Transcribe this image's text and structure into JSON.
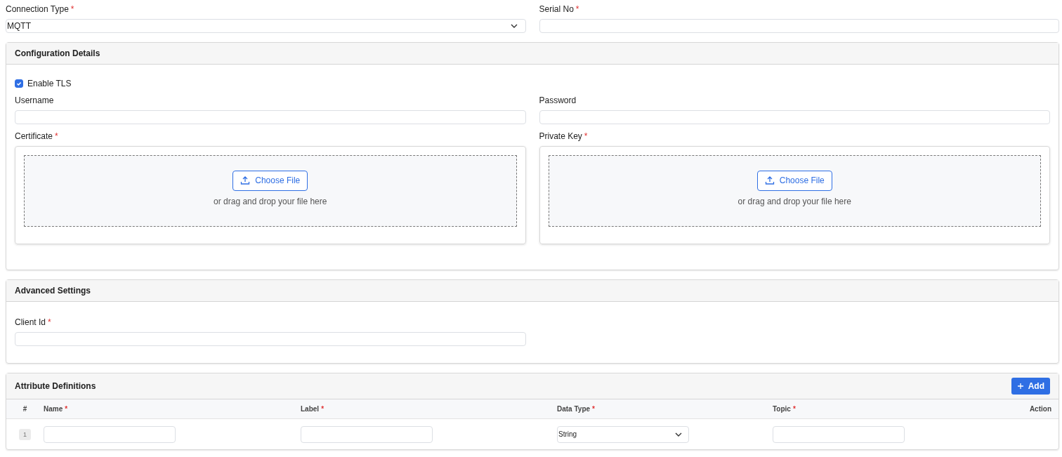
{
  "top_fields": [
    {
      "label": "Connection Type",
      "mark": "*",
      "kind": "select",
      "value": "MQTT"
    },
    {
      "label": "Serial No",
      "mark": "*",
      "kind": "text"
    }
  ],
  "configuration": {
    "title": "Configuration Details",
    "enable_tls": {
      "label": "Enable TLS",
      "checked": true
    },
    "fields": [
      {
        "label": "Username"
      },
      {
        "label": "Password"
      }
    ],
    "uploads": [
      {
        "label": "Certificate",
        "mark": "*",
        "button": "Choose File",
        "hint": "or drag and drop your file here"
      },
      {
        "label": "Private Key",
        "mark": "*",
        "button": "Choose File",
        "hint": "or drag and drop your file here"
      }
    ]
  },
  "advanced": {
    "title": "Advanced Settings",
    "fields": [
      {
        "label": "Client Id",
        "mark": "*"
      }
    ]
  },
  "attributes": {
    "title": "Attribute Definitions",
    "add_button": "Add",
    "columns": [
      {
        "label": "#"
      },
      {
        "label": "Name",
        "mark": "*"
      },
      {
        "label": "Label",
        "mark": "*"
      },
      {
        "label": "Data Type",
        "mark": "*"
      },
      {
        "label": "Topic",
        "mark": "*"
      },
      {
        "label": "Action"
      }
    ],
    "rows": [
      {
        "index": "1",
        "data_type": "String"
      }
    ]
  }
}
